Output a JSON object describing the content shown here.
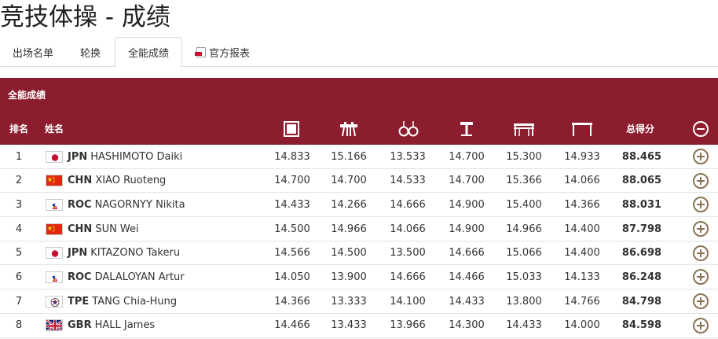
{
  "page": {
    "title": "竞技体操 - 成绩"
  },
  "tabs": [
    {
      "label": "出场名单",
      "active": false
    },
    {
      "label": "轮换",
      "active": false
    },
    {
      "label": "全能成绩",
      "active": true
    },
    {
      "label": "官方报表",
      "active": false,
      "icon": "pdf-icon"
    }
  ],
  "section": {
    "title": "全能成绩"
  },
  "table": {
    "headers": {
      "rank": "排名",
      "name": "姓名",
      "total": "总得分"
    },
    "apparatus_icons": [
      "floor-exercise-icon",
      "pommel-horse-icon",
      "rings-icon",
      "vault-icon",
      "parallel-bars-icon",
      "horizontal-bar-icon"
    ],
    "rows": [
      {
        "rank": "1",
        "noc": "JPN",
        "name": "HASHIMOTO Daiki",
        "flag": "jpn",
        "scores": [
          "14.833",
          "15.166",
          "13.533",
          "14.700",
          "15.300",
          "14.933"
        ],
        "total": "88.465"
      },
      {
        "rank": "2",
        "noc": "CHN",
        "name": "XIAO Ruoteng",
        "flag": "chn",
        "scores": [
          "14.700",
          "14.700",
          "14.533",
          "14.700",
          "15.366",
          "14.066"
        ],
        "total": "88.065"
      },
      {
        "rank": "3",
        "noc": "ROC",
        "name": "NAGORNYY Nikita",
        "flag": "roc",
        "scores": [
          "14.433",
          "14.266",
          "14.666",
          "14.900",
          "15.400",
          "14.366"
        ],
        "total": "88.031"
      },
      {
        "rank": "4",
        "noc": "CHN",
        "name": "SUN Wei",
        "flag": "chn",
        "scores": [
          "14.500",
          "14.966",
          "14.066",
          "14.900",
          "14.966",
          "14.400"
        ],
        "total": "87.798"
      },
      {
        "rank": "5",
        "noc": "JPN",
        "name": "KITAZONO Takeru",
        "flag": "jpn",
        "scores": [
          "14.566",
          "14.500",
          "13.500",
          "14.666",
          "15.066",
          "14.400"
        ],
        "total": "86.698"
      },
      {
        "rank": "6",
        "noc": "ROC",
        "name": "DALALOYAN Artur",
        "flag": "roc",
        "scores": [
          "14.050",
          "13.900",
          "14.666",
          "14.466",
          "15.033",
          "14.133"
        ],
        "total": "86.248"
      },
      {
        "rank": "7",
        "noc": "TPE",
        "name": "TANG Chia-Hung",
        "flag": "tpe",
        "scores": [
          "14.366",
          "13.333",
          "14.100",
          "14.433",
          "13.800",
          "14.766"
        ],
        "total": "84.798"
      },
      {
        "rank": "8",
        "noc": "GBR",
        "name": "HALL James",
        "flag": "gbr",
        "scores": [
          "14.466",
          "13.433",
          "13.966",
          "14.300",
          "14.433",
          "14.000"
        ],
        "total": "84.598"
      }
    ]
  },
  "colors": {
    "header_bg": "#8b1d2e",
    "expand_icon": "#8a7353",
    "row_border": "#e3e3e3"
  }
}
